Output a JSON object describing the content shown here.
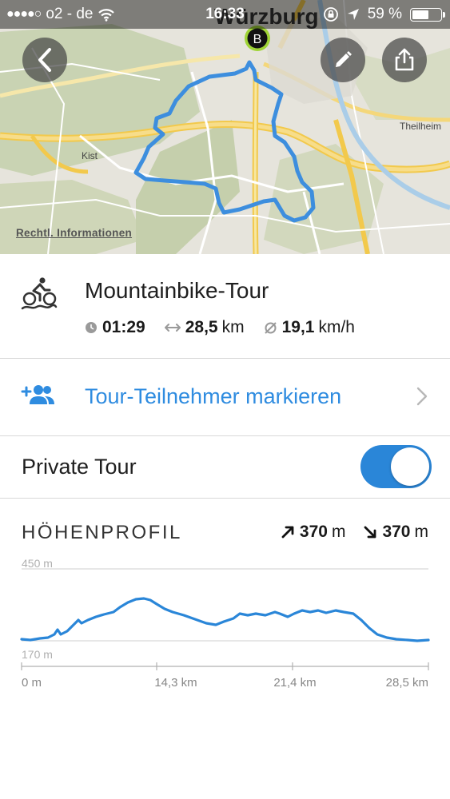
{
  "status_bar": {
    "carrier": "o2 - de",
    "time": "16:33",
    "battery": "59 %",
    "battery_level": 0.59
  },
  "map": {
    "city_label": "Würzburg",
    "place_labels": [
      "Kist",
      "Theilheim"
    ],
    "legal_link": "Rechtl. Informationen",
    "marker_label": "B",
    "route_color": "#3d8ede"
  },
  "tour": {
    "type": "Mountainbike-Tour",
    "duration": "01:29",
    "distance_value": "28,5",
    "distance_unit": "km",
    "speed_value": "19,1",
    "speed_unit": "km/h"
  },
  "participants": {
    "label": "Tour-Teilnehmer markieren"
  },
  "private_tour": {
    "label": "Private Tour",
    "enabled": true
  },
  "elevation": {
    "title": "HÖHENPROFIL",
    "ascent_value": "370",
    "ascent_unit": "m",
    "descent_value": "370",
    "descent_unit": "m",
    "y_max_label": "450 m",
    "y_min_label": "170 m",
    "x_ticks": [
      "0 m",
      "14,3 km",
      "21,4 km",
      "28,5 km"
    ]
  },
  "colors": {
    "accent": "#2f8ce0",
    "toggle_on": "#2a86d8"
  }
}
